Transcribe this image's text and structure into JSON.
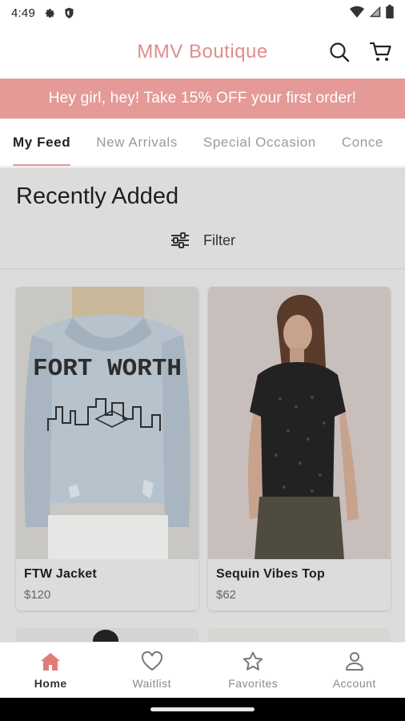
{
  "status_bar": {
    "time": "4:49",
    "left_icons": [
      "settings-gear-icon",
      "shield-icon"
    ],
    "right_icons": [
      "wifi-icon",
      "signal-icon",
      "battery-icon"
    ]
  },
  "app_bar": {
    "title": "MMV Boutique",
    "title_color": "#e08c8c",
    "icons": [
      "search-icon",
      "cart-icon"
    ]
  },
  "promo": {
    "text": "Hey girl, hey! Take 15% OFF your first order!",
    "background": "#e59a98"
  },
  "tabs": [
    {
      "label": "My Feed",
      "active": true
    },
    {
      "label": "New Arrivals",
      "active": false
    },
    {
      "label": "Special Occasion",
      "active": false
    },
    {
      "label": "Conce",
      "active": false
    }
  ],
  "main": {
    "section_title": "Recently Added",
    "filter_label": "Filter",
    "products": [
      {
        "name": "FTW Jacket",
        "price": "$120",
        "image": "denim-jacket-photo",
        "print_line1": "FORT WORTH"
      },
      {
        "name": "Sequin Vibes Top",
        "price": "$62",
        "image": "black-sequin-top-photo"
      }
    ]
  },
  "bottom_nav": [
    {
      "label": "Home",
      "icon": "home-icon",
      "active": true
    },
    {
      "label": "Waitlist",
      "icon": "heart-icon",
      "active": false
    },
    {
      "label": "Favorites",
      "icon": "star-icon",
      "active": false
    },
    {
      "label": "Account",
      "icon": "person-icon",
      "active": false
    }
  ],
  "colors": {
    "accent": "#e59a98",
    "active_home_icon": "#e07d7a"
  }
}
